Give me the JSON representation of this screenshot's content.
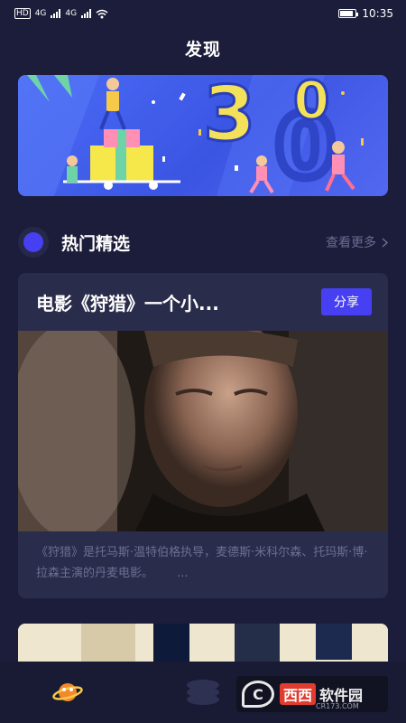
{
  "status_bar": {
    "left_badges": [
      "HD",
      "4G",
      "4G"
    ],
    "time": "10:35",
    "battery_level": 0.85
  },
  "header": {
    "title": "发现"
  },
  "banner": {
    "image": "promo-banner-30-celebration"
  },
  "section": {
    "title": "热门精选",
    "see_more": "查看更多"
  },
  "featured_card": {
    "title": "电影《狩猎》一个小...",
    "share_label": "分享",
    "image": "movie-still-portrait",
    "description": "《狩猎》是托马斯·温特伯格执导，麦德斯·米科尔森、托玛斯·博·拉森主演的丹麦电影。",
    "ellipsis": "..."
  },
  "tab_bar": {
    "tabs": [
      {
        "name": "discover",
        "icon": "planet-icon",
        "active": true
      },
      {
        "name": "library",
        "icon": "stack-icon",
        "active": false
      },
      {
        "name": "profile",
        "icon": "user-icon",
        "active": false
      }
    ]
  },
  "watermark": {
    "red_text": "西西",
    "white_text": "软件园",
    "sub_text": "CR173.COM"
  },
  "colors": {
    "background": "#1c1d3a",
    "card": "#2a2c4b",
    "accent": "#4640f2",
    "muted_text": "#6d6f94"
  }
}
